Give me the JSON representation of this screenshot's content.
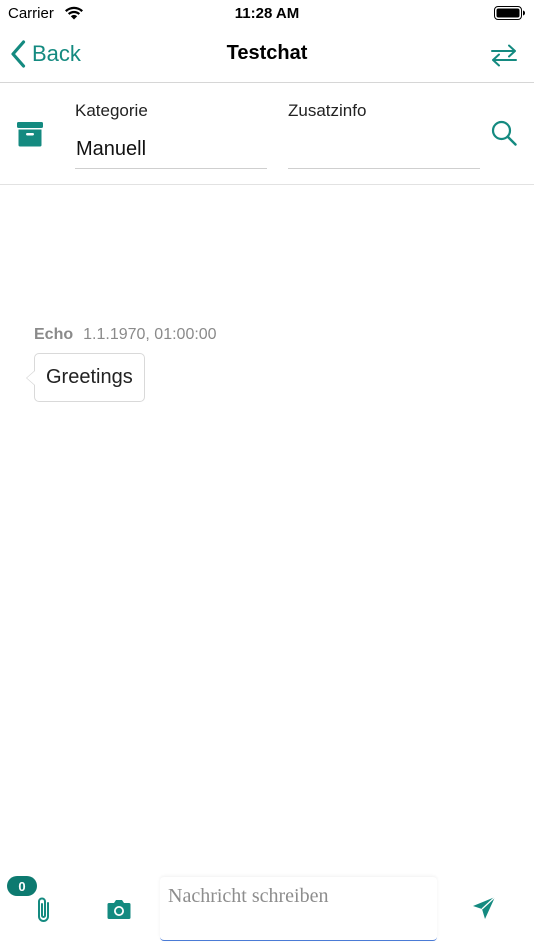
{
  "status_bar": {
    "carrier": "Carrier",
    "time": "11:28 AM"
  },
  "nav": {
    "back_label": "Back",
    "title": "Testchat"
  },
  "filters": {
    "category_label": "Kategorie",
    "category_value": "Manuell",
    "extra_label": "Zusatzinfo",
    "extra_value": ""
  },
  "messages": [
    {
      "sender": "Echo",
      "timestamp": "1.1.1970, 01:00:00",
      "text": "Greetings"
    }
  ],
  "composer": {
    "attachment_count": "0",
    "placeholder": "Nachricht schreiben",
    "value": ""
  },
  "colors": {
    "accent": "#148a80",
    "badge": "#0d7a70",
    "input_underline": "#4a7bd6"
  },
  "icons": {
    "wifi": "wifi-icon",
    "battery": "battery-icon",
    "back": "chevron-left-icon",
    "swap": "swap-arrows-icon",
    "archive": "archive-box-icon",
    "search": "search-icon",
    "attach": "paperclip-icon",
    "camera": "camera-icon",
    "send": "send-icon"
  }
}
